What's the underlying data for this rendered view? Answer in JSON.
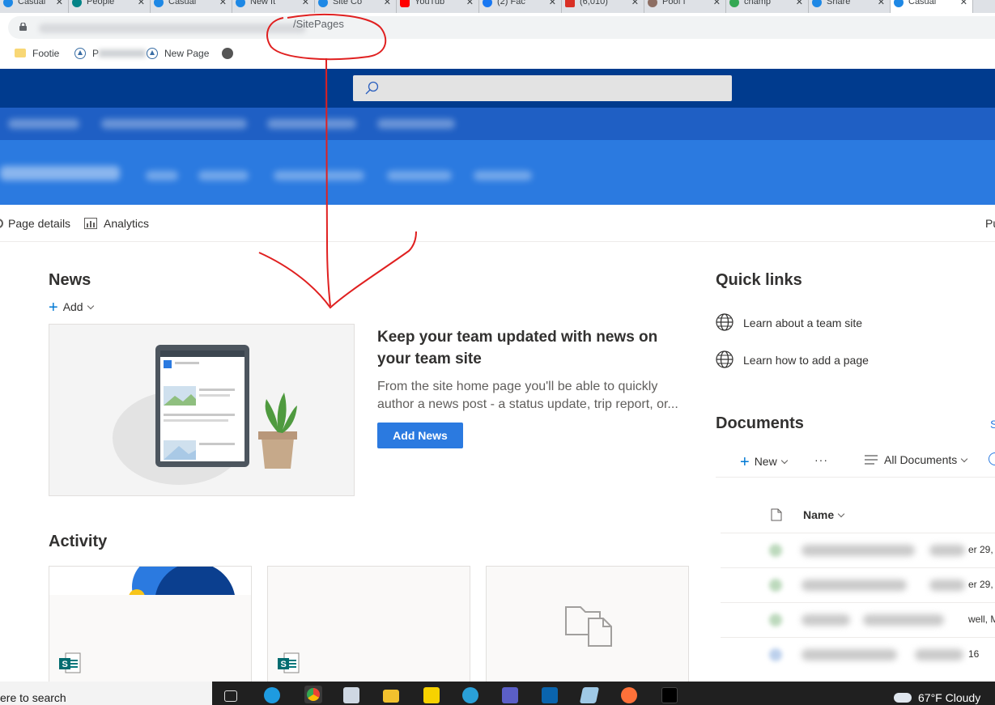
{
  "browser": {
    "tabs": [
      {
        "label": "Casual",
        "color": "#1e88e5"
      },
      {
        "label": "People",
        "color": "#038387"
      },
      {
        "label": "Casual",
        "color": "#1e88e5"
      },
      {
        "label": "New It",
        "color": "#1e88e5"
      },
      {
        "label": "Site Co",
        "color": "#1e88e5"
      },
      {
        "label": "YouTub",
        "color": "#ff0000"
      },
      {
        "label": "(2) Fac",
        "color": "#1877f2"
      },
      {
        "label": "(6,010)",
        "color": "#d93025"
      },
      {
        "label": "Poof f",
        "color": "#8d6e63"
      },
      {
        "label": "champ",
        "color": "#34a853"
      },
      {
        "label": "Share",
        "color": "#1e88e5"
      },
      {
        "label": "Casual",
        "color": "#1e88e5"
      }
    ],
    "url_path": "/SitePages",
    "bookmarks": {
      "footie": "Footie",
      "second": "P",
      "new_page": "New Page"
    }
  },
  "commandbar": {
    "page_details": "Page details",
    "analytics": "Analytics",
    "right_label": "Pu"
  },
  "news": {
    "heading": "News",
    "add_label": "Add",
    "card_title": "Keep your team updated with news on your team site",
    "card_desc": "From the site home page you'll be able to quickly author a news post - a status update, trip report, or...",
    "button": "Add News"
  },
  "activity": {
    "heading": "Activity"
  },
  "quick_links": {
    "heading": "Quick links",
    "items": [
      "Learn about a team site",
      "Learn how to add a page"
    ]
  },
  "documents": {
    "heading": "Documents",
    "right_cut": "S",
    "new_label": "New",
    "more": "···",
    "view_label": "All Documents",
    "name_header": "Name",
    "row_tails": [
      "er 29, ",
      "er 29, ",
      "well, M",
      "16"
    ]
  },
  "taskbar": {
    "search": "ere to search",
    "weather": "67°F  Cloudy"
  },
  "colors": {
    "suite_bar": "#003b8e",
    "hub_nav": "#1f5fc4",
    "site_header": "#2b7ae0",
    "accent": "#2b7ae0",
    "annotation": "#e02020"
  }
}
